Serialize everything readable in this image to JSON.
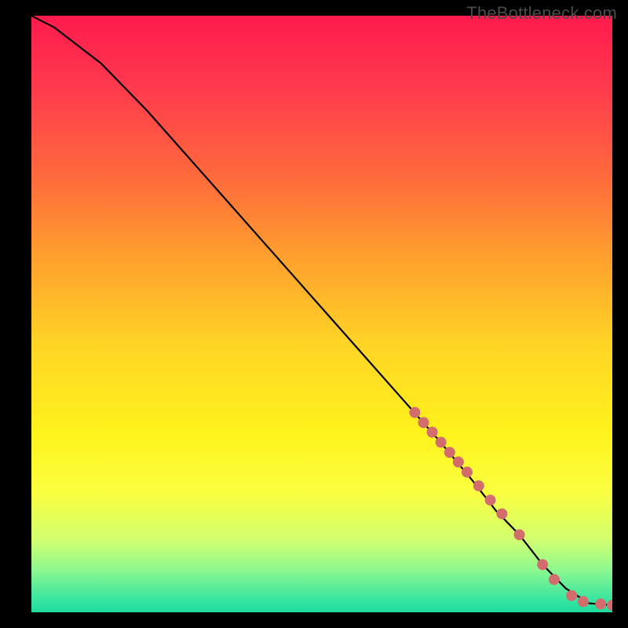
{
  "watermark": "TheBottleneck.com",
  "gradient_colors": {
    "top": "#ff1a4d",
    "yellow": "#fff31c",
    "green": "#20dca0"
  },
  "chart_data": {
    "type": "line",
    "title": "",
    "xlabel": "",
    "ylabel": "",
    "xlim": [
      0,
      100
    ],
    "ylim": [
      0,
      100
    ],
    "curve": {
      "name": "bottleneck-curve",
      "x": [
        0,
        4,
        8,
        12,
        20,
        30,
        40,
        50,
        60,
        70,
        76,
        80,
        84,
        88,
        92,
        96,
        100
      ],
      "y": [
        100,
        98,
        95,
        92,
        84,
        73,
        62,
        51,
        40,
        29,
        22,
        17,
        13,
        8,
        4,
        1.5,
        1.2
      ]
    },
    "markers": {
      "name": "highlighted-segment",
      "color": "#d36d6d",
      "radius_px": 7,
      "x": [
        66,
        67.5,
        69,
        70.5,
        72,
        73.5,
        75,
        77,
        79,
        81,
        84,
        88,
        90,
        93,
        95,
        98,
        100
      ],
      "y": [
        33.5,
        31.8,
        30.2,
        28.5,
        26.8,
        25.2,
        23.5,
        21.2,
        18.8,
        16.5,
        13.0,
        8.0,
        5.5,
        2.8,
        1.8,
        1.4,
        1.2
      ]
    }
  }
}
